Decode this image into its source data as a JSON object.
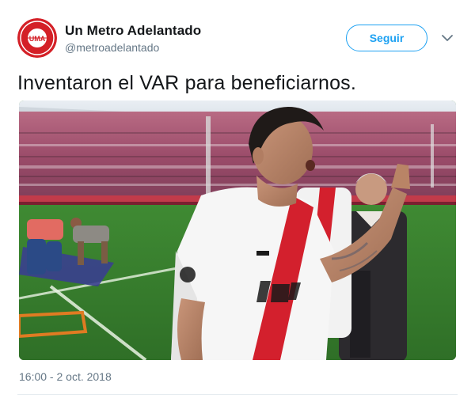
{
  "tweet": {
    "author": {
      "name": "Un Metro Adelantado",
      "handle": "@metroadelantado",
      "avatar_text": "UMA"
    },
    "follow_label": "Seguir",
    "text": "Inventaron el VAR para beneficiarnos.",
    "timestamp": "16:00 - 2 oct. 2018"
  },
  "colors": {
    "accent": "#1da1f2",
    "secondary_text": "#657786",
    "avatar": "#d42027"
  },
  "icons": {
    "menu": "chevron-down-icon"
  }
}
